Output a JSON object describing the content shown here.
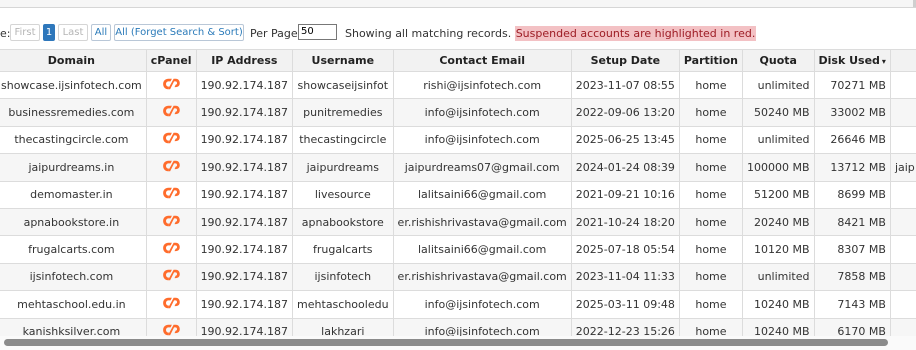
{
  "pager": {
    "prefix": "e:",
    "first": "First",
    "current_page": "1",
    "last": "Last",
    "all": "All",
    "forget": "All (Forget Search & Sort)",
    "per_page_label": "Per Page:",
    "per_page_value": "50",
    "status_text": "Showing all matching records.",
    "status_highlight": "Suspended accounts are highlighted in red."
  },
  "table": {
    "headers": {
      "domain": "Domain",
      "cpanel": "cPanel",
      "ip": "IP Address",
      "username": "Username",
      "email": "Contact Email",
      "setup": "Setup Date",
      "partition": "Partition",
      "quota": "Quota",
      "disk": "Disk Used",
      "disk_sort": "▾"
    },
    "rows": [
      {
        "domain": "showcase.ijsinfotech.com",
        "ip": "190.92.174.187",
        "username": "showcaseijsinfot",
        "email": "rishi@ijsinfotech.com",
        "setup": "2023-11-07 08:55",
        "partition": "home",
        "quota": "unlimited",
        "disk": "70271 MB",
        "extra": ""
      },
      {
        "domain": "businessremedies.com",
        "ip": "190.92.174.187",
        "username": "punitremedies",
        "email": "info@ijsinfotech.com",
        "setup": "2022-09-06 13:20",
        "partition": "home",
        "quota": "50240 MB",
        "disk": "33002 MB",
        "extra": ""
      },
      {
        "domain": "thecastingcircle.com",
        "ip": "190.92.174.187",
        "username": "thecastingcircle",
        "email": "info@ijsinfotech.com",
        "setup": "2025-06-25 13:45",
        "partition": "home",
        "quota": "unlimited",
        "disk": "26646 MB",
        "extra": ""
      },
      {
        "domain": "jaipurdreams.in",
        "ip": "190.92.174.187",
        "username": "jaipurdreams",
        "email": "jaipurdreams07@gmail.com",
        "setup": "2024-01-24 08:39",
        "partition": "home",
        "quota": "100000 MB",
        "disk": "13712 MB",
        "extra": "jaip"
      },
      {
        "domain": "demomaster.in",
        "ip": "190.92.174.187",
        "username": "livesource",
        "email": "lalitsaini66@gmail.com",
        "setup": "2021-09-21 10:16",
        "partition": "home",
        "quota": "51200 MB",
        "disk": "8699 MB",
        "extra": ""
      },
      {
        "domain": "apnabookstore.in",
        "ip": "190.92.174.187",
        "username": "apnabookstore",
        "email": "er.rishishrivastava@gmail.com",
        "setup": "2021-10-24 18:20",
        "partition": "home",
        "quota": "20240 MB",
        "disk": "8421 MB",
        "extra": ""
      },
      {
        "domain": "frugalcarts.com",
        "ip": "190.92.174.187",
        "username": "frugalcarts",
        "email": "lalitsaini66@gmail.com",
        "setup": "2025-07-18 05:54",
        "partition": "home",
        "quota": "10120 MB",
        "disk": "8307 MB",
        "extra": ""
      },
      {
        "domain": "ijsinfotech.com",
        "ip": "190.92.174.187",
        "username": "ijsinfotech",
        "email": "er.rishishrivastava@gmail.com",
        "setup": "2023-11-04 11:33",
        "partition": "home",
        "quota": "unlimited",
        "disk": "7858 MB",
        "extra": ""
      },
      {
        "domain": "mehtaschool.edu.in",
        "ip": "190.92.174.187",
        "username": "mehtaschooledu",
        "email": "info@ijsinfotech.com",
        "setup": "2025-03-11 09:48",
        "partition": "home",
        "quota": "10240 MB",
        "disk": "7143 MB",
        "extra": ""
      },
      {
        "domain": "kanishksilver.com",
        "ip": "190.92.174.187",
        "username": "lakhzari",
        "email": "info@ijsinfotech.com",
        "setup": "2022-12-23 15:26",
        "partition": "home",
        "quota": "10240 MB",
        "disk": "6170 MB",
        "extra": ""
      }
    ]
  },
  "icons": {
    "cpanel": "cpanel-logo-icon"
  },
  "colors": {
    "link": "#2a7ab9",
    "cpanel_orange": "#ff6c2c",
    "highlight_bg": "#f3c1c4",
    "highlight_text": "#9d1c24",
    "page_current": "#2e77bb"
  }
}
